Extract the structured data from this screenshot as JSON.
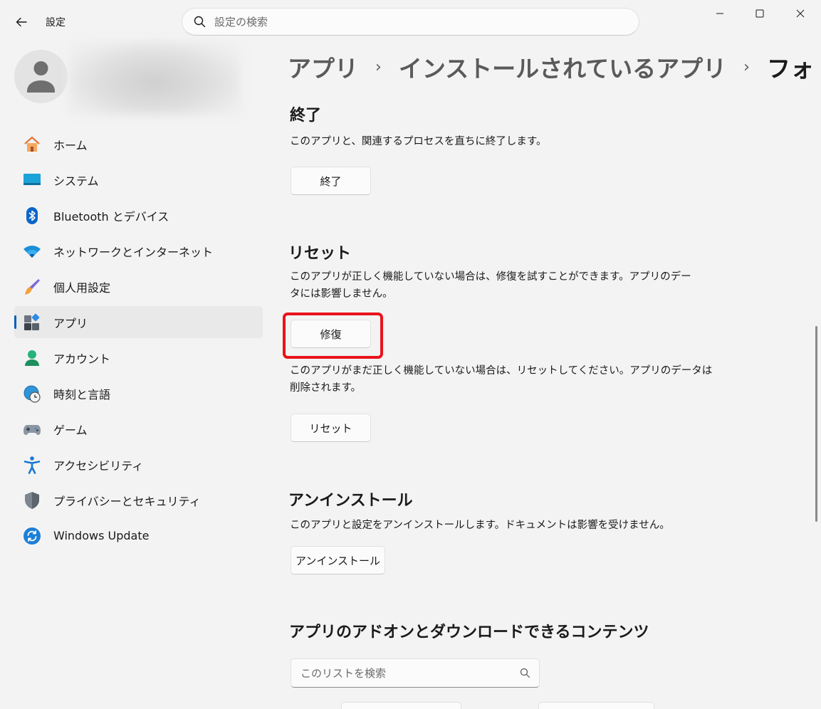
{
  "window": {
    "title": "設定",
    "search_placeholder": "設定の検索"
  },
  "sidebar": {
    "items": [
      {
        "label": "ホーム",
        "icon": "home-icon"
      },
      {
        "label": "システム",
        "icon": "system-icon"
      },
      {
        "label": "Bluetooth とデバイス",
        "icon": "bluetooth-icon"
      },
      {
        "label": "ネットワークとインターネット",
        "icon": "wifi-icon"
      },
      {
        "label": "個人用設定",
        "icon": "brush-icon"
      },
      {
        "label": "アプリ",
        "icon": "apps-icon",
        "active": true
      },
      {
        "label": "アカウント",
        "icon": "account-icon"
      },
      {
        "label": "時刻と言語",
        "icon": "time-language-icon"
      },
      {
        "label": "ゲーム",
        "icon": "gamepad-icon"
      },
      {
        "label": "アクセシビリティ",
        "icon": "accessibility-icon"
      },
      {
        "label": "プライバシーとセキュリティ",
        "icon": "shield-icon"
      },
      {
        "label": "Windows Update",
        "icon": "update-icon"
      }
    ]
  },
  "breadcrumb": {
    "level1": "アプリ",
    "level2": "インストールされているアプリ",
    "current": "フォト",
    "separator": "›"
  },
  "sections": {
    "terminate": {
      "heading": "終了",
      "description": "このアプリと、関連するプロセスを直ちに終了します。",
      "button": "終了"
    },
    "reset": {
      "heading": "リセット",
      "repair_description_line1": "このアプリが正しく機能していない場合は、修復を試すことができます。アプリのデー",
      "repair_description_line2": "タには影響しません。",
      "repair_button": "修復",
      "reset_description_line1": "このアプリがまだ正しく機能していない場合は、リセットしてください。アプリのデータは",
      "reset_description_line2": "削除されます。",
      "reset_button": "リセット"
    },
    "uninstall": {
      "heading": "アンインストール",
      "description": "このアプリと設定をアンインストールします。ドキュメントは影響を受けません。",
      "button": "アンインストール"
    },
    "addons": {
      "heading": "アプリのアドオンとダウンロードできるコンテンツ",
      "search_placeholder": "このリストを検索"
    }
  },
  "colors": {
    "accent": "#005fb8",
    "highlight": "#e8141c",
    "background": "#f3f3f3"
  }
}
